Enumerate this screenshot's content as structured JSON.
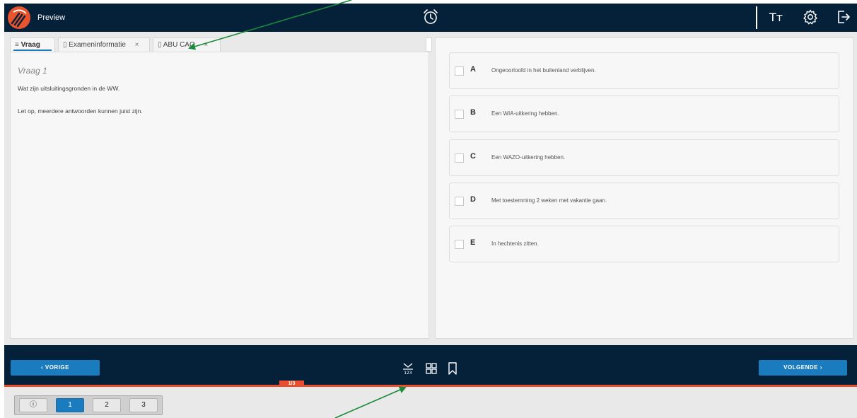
{
  "header": {
    "preview_label": "Preview",
    "icons": [
      "logo",
      "alarm-clock-icon",
      "text-size-icon",
      "settings-icon",
      "exit-icon"
    ],
    "textsize_label": "Tт"
  },
  "tabs": [
    {
      "icon": "list-icon",
      "label": "Vraag",
      "active": true,
      "closable": false
    },
    {
      "icon": "document-icon",
      "label": "Exameninformatie",
      "close": "×"
    },
    {
      "icon": "document-icon",
      "label": "ABU CAO",
      "close": "×"
    }
  ],
  "question": {
    "title": "Vraag 1",
    "text": "Wat zijn uitsluitingsgronden in de WW.",
    "note": "Let op, meerdere antwoorden kunnen juist zijn."
  },
  "options": [
    {
      "letter": "A",
      "text": "Ongeoorloofd in het buitenland verblijven."
    },
    {
      "letter": "B",
      "text": "Een WIA-uitkering hebben."
    },
    {
      "letter": "C",
      "text": "Een WAZO-uitkering hebben."
    },
    {
      "letter": "D",
      "text": "Met toestemming 2 weken met vakantie gaan."
    },
    {
      "letter": "E",
      "text": "In hechtenis zitten."
    }
  ],
  "footer": {
    "prev_label": "‹  VORIGE",
    "next_label": "VOLGENDE  ›",
    "progress_label": "1/3",
    "progress_fraction": 0.333,
    "tools": [
      "sort-123-icon",
      "grid-icon",
      "bookmark-icon"
    ]
  },
  "pager": {
    "info_label": "ⓘ",
    "pages": [
      "1",
      "2",
      "3"
    ],
    "current": "1"
  },
  "colors": {
    "navy": "#05213a",
    "accent_blue": "#1a7bbf",
    "progress_orange": "#e94e2e",
    "arrow_green": "#1a8a3a"
  }
}
